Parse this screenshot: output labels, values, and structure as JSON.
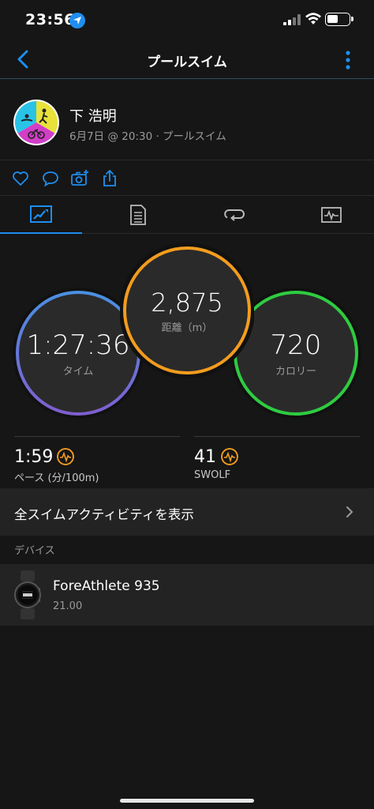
{
  "status_bar": {
    "time": "23:56"
  },
  "nav": {
    "title": "プールスイム"
  },
  "profile": {
    "name": "下 浩明",
    "subtitle": "6月7日 @ 20:30 · プールスイム"
  },
  "stats": {
    "time": {
      "value": "1:27:36",
      "label": "タイム"
    },
    "distance": {
      "value": "2,875",
      "label": "距離（m）"
    },
    "calories": {
      "value": "720",
      "label": "カロリー"
    }
  },
  "metrics": {
    "pace": {
      "value": "1:59",
      "label": "ペース (分/100m)"
    },
    "swolf": {
      "value": "41",
      "label": "SWOLF"
    }
  },
  "all_swim_label": "全スイムアクティビティを表示",
  "device_section_title": "デバイス",
  "device": {
    "name": "ForeAthlete 935",
    "version": "21.00"
  },
  "colors": {
    "accent": "#1e8ef0",
    "time_ring_start": "#4a90e2",
    "time_ring_end": "#7e5fd0",
    "distance_ring": "#f39c1e",
    "calories_ring": "#2ecc40",
    "metric_icon": "#f39c1e"
  }
}
